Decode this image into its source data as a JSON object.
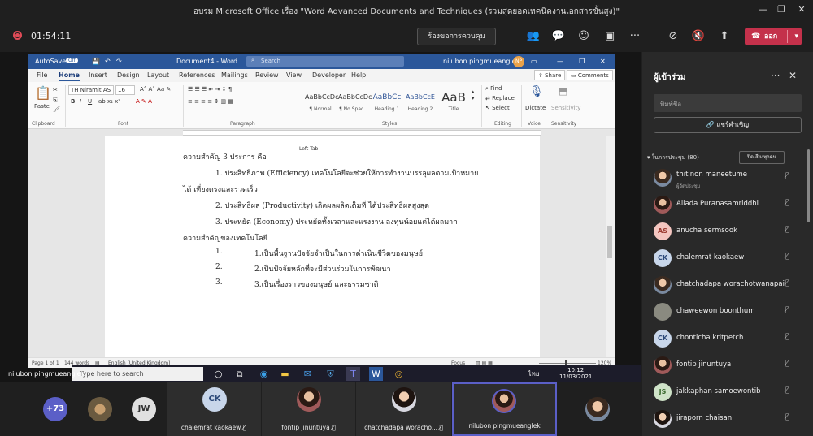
{
  "window": {
    "title": "อบรม Microsoft Office เรื่อง \"Word Advanced Documents and Techniques (รวมสุดยอดเทคนิคงานเอกสารขั้นสูง)\""
  },
  "meeting": {
    "timer": "01:54:11",
    "control_request_label": "ร้องขอการควบคุม",
    "leave_label": "ออก"
  },
  "word": {
    "autosave_label": "AutoSave",
    "autosave_state": "Off",
    "doc_title": "Document4 - Word",
    "search_placeholder": "Search",
    "user_name": "nilubon pingmueanglek",
    "user_initials": "NP",
    "menu": [
      "File",
      "Home",
      "Insert",
      "Design",
      "Layout",
      "References",
      "Mailings",
      "Review",
      "View",
      "Developer",
      "Help"
    ],
    "share_label": "Share",
    "comments_label": "Comments",
    "font_name": "TH Niramit AS",
    "font_size": "16",
    "paste_label": "Paste",
    "styles": [
      {
        "sample": "AaBbCcDc",
        "name": "¶ Normal"
      },
      {
        "sample": "AaBbCcDc",
        "name": "¶ No Spac..."
      },
      {
        "sample": "AaBbCc",
        "name": "Heading 1"
      },
      {
        "sample": "AaBbCcE",
        "name": "Heading 2"
      },
      {
        "sample": "AaB",
        "name": "Title"
      }
    ],
    "find_label": "Find",
    "replace_label": "Replace",
    "select_label": "Select",
    "dictate_label": "Dictate",
    "sensitivity_label": "Sensitivity",
    "groups": [
      "Clipboard",
      "Font",
      "Paragraph",
      "Styles",
      "Editing",
      "Voice",
      "Sensitivity"
    ],
    "tooltip": "Left Tab",
    "doc_lines": [
      "ความสำคัญ 3 ประการ คือ",
      "1.  ประสิทธิภาพ (Efficiency) เทคโนโลยีจะช่วยให้การทำงานบรรลุผลตามเป้าหมาย",
      "ได้ เที่ยงตรงและรวดเร็ว",
      "2.  ประสิทธิผล (Productivity) เกิดผลผลิตเต็มที่ ได้ประสิทธิผลสูงสุด",
      "3.  ประหยัด (Economy) ประหยัดทั้งเวลาและแรงงาน ลงทุนน้อยแต่ได้ผลมาก",
      "ความสำคัญของเทคโนโลยี"
    ],
    "list_items": [
      {
        "num": "1.",
        "text": "1.เป็นพื้นฐานปัจจัยจำเป็นในการดำเนินชีวิตของมนุษย์"
      },
      {
        "num": "2.",
        "text": "2.เป็นปัจจัยหลักที่จะมีส่วนร่วมในการพัฒนา"
      },
      {
        "num": "3.",
        "text": "3.เป็นเรื่องราวของมนุษย์ และธรรมชาติ"
      }
    ],
    "status": {
      "page": "Page 1 of 1",
      "words": "144 words",
      "language": "English (United Kingdom)",
      "focus": "Focus",
      "zoom": "120%"
    }
  },
  "taskbar": {
    "search_text": "Type here to search",
    "time": "10:12",
    "date": "11/03/2021",
    "lang": "ไทย"
  },
  "sharer_name": "nilubon pingmueanglek",
  "participants_panel": {
    "title": "ผู้เข้าร่วม",
    "search_placeholder": "พิมพ์ชื่อ",
    "invite_label": "แชร์คำเชิญ",
    "in_meeting_label": "ในการประชุม (80)",
    "mute_all_label": "ปิดเสียงทุกคน",
    "organizer_label": "ผู้จัดประชุม",
    "people": [
      {
        "name": "thitinon maneetume",
        "initials": "",
        "color": "#b0b0b0"
      },
      {
        "name": "Ailada Puranasamriddhi",
        "initials": "",
        "color": "#d9b8a8"
      },
      {
        "name": "anucha sermsook",
        "initials": "AS",
        "color": "#f4c6c0"
      },
      {
        "name": "chalemrat kaokaew",
        "initials": "CK",
        "color": "#c8d6ea"
      },
      {
        "name": "chatchadapa worachotwanapai",
        "initials": "",
        "color": "#c0a8a0"
      },
      {
        "name": "chaweewon boonthum",
        "initials": "",
        "color": "#8a8a80"
      },
      {
        "name": "chonticha kritpetch",
        "initials": "CK",
        "color": "#c8d6ea"
      },
      {
        "name": "fontip jinuntuya",
        "initials": "",
        "color": "#d0a898"
      },
      {
        "name": "jakkaphan samoewontib",
        "initials": "JS",
        "color": "#cfe3c8"
      },
      {
        "name": "jiraporn chaisan",
        "initials": "",
        "color": "#a8a8a8"
      }
    ]
  },
  "strip": {
    "overflow": "+73",
    "tiles": [
      {
        "name": "",
        "initials": ""
      },
      {
        "name": "",
        "initials": "JW"
      },
      {
        "name": "chalemrat kaokaew",
        "initials": "CK"
      },
      {
        "name": "fontip jinuntuya",
        "initials": ""
      },
      {
        "name": "chatchadapa woracho...",
        "initials": ""
      },
      {
        "name": "nilubon pingmueanglek",
        "initials": ""
      },
      {
        "name": "",
        "initials": ""
      }
    ]
  },
  "colors": {
    "accent": "#5b5fc7",
    "leave": "#c4314b",
    "word_blue": "#2b579a"
  }
}
